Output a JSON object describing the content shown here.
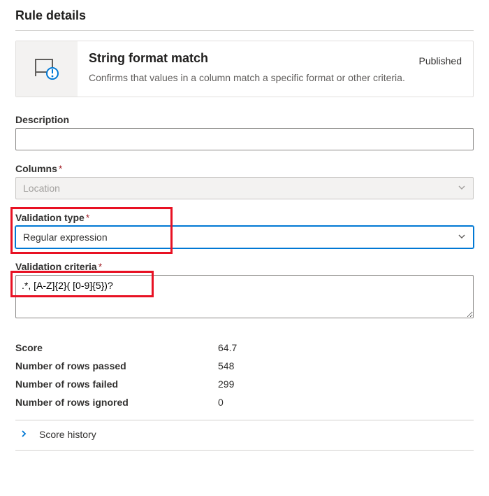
{
  "header": {
    "title": "Rule details"
  },
  "summary": {
    "title": "String format match",
    "description": "Confirms that values in a column match a specific format or other criteria.",
    "status": "Published"
  },
  "fields": {
    "description_label": "Description",
    "description_value": "",
    "columns_label": "Columns",
    "columns_value": "Location",
    "validation_type_label": "Validation type",
    "validation_type_value": "Regular expression",
    "validation_criteria_label": "Validation criteria",
    "validation_criteria_value": ".*, [A-Z]{2}( [0-9]{5})?"
  },
  "stats": {
    "score_label": "Score",
    "score_value": "64.7",
    "passed_label": "Number of rows passed",
    "passed_value": "548",
    "failed_label": "Number of rows failed",
    "failed_value": "299",
    "ignored_label": "Number of rows ignored",
    "ignored_value": "0"
  },
  "expander": {
    "label": "Score history"
  }
}
